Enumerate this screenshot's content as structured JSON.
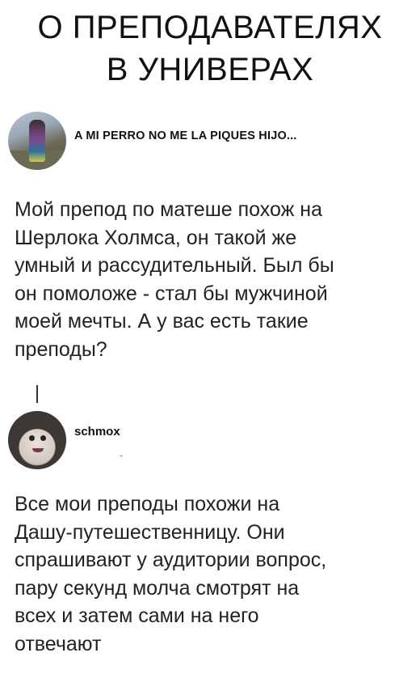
{
  "title": {
    "line1": "О ПРЕПОДАВАТЕЛЯХ",
    "line2": "В УНИВЕРАХ"
  },
  "post": {
    "username": "A MI PERRO NO ME LA PIQUES HIJO...",
    "lines": [
      "Мой препод по матеше похож на",
      "Шерлока Холмса, он такой же",
      "умный и рассудительный. Был бы",
      "он помоложе - стал бы мужчиной",
      "моей мечты. А у вас есть такие",
      "преподы?"
    ]
  },
  "reply": {
    "username": "schmox",
    "lines": [
      "Все мои преподы похожи на",
      "Дашу-путешественницу. Они",
      "спрашивают у аудитории вопрос,",
      "пару секунд молча смотрят на",
      "всех и затем сами на него",
      "отвечают"
    ]
  }
}
